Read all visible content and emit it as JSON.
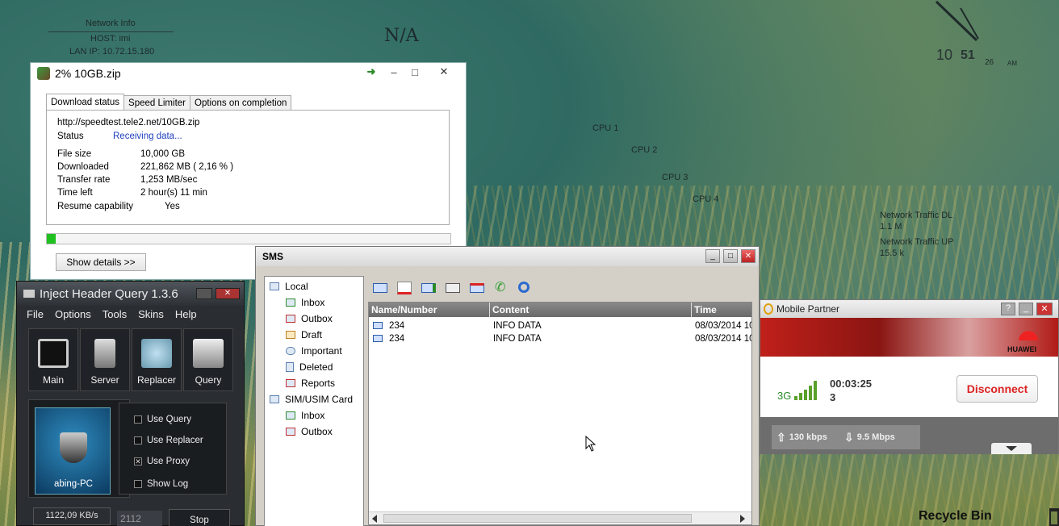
{
  "desktop": {
    "network_info_title": "Network Info",
    "host": "HOST: imi",
    "lan_ip": "LAN IP: 10.72.15.180",
    "na": "N/A",
    "cpu1": "CPU 1",
    "cpu2": "CPU 2",
    "cpu3": "CPU 3",
    "cpu4": "CPU 4",
    "traffic_dl_label": "Network Traffic DL",
    "traffic_dl_value": "1.1 M",
    "traffic_ul_label": "Network Traffic UP",
    "traffic_ul_value": "15.5 k",
    "clock_hour": "10",
    "clock_min": "51",
    "clock_day": "26",
    "clock_ampm": "AM",
    "recycle_bin": "Recycle Bin"
  },
  "download": {
    "title": "2% 10GB.zip",
    "tabs": [
      "Download status",
      "Speed Limiter",
      "Options on completion"
    ],
    "url": "http://speedtest.tele2.net/10GB.zip",
    "status_label": "Status",
    "status_value": "Receiving data...",
    "file_size_label": "File size",
    "file_size_value": "10,000  GB",
    "downloaded_label": "Downloaded",
    "downloaded_value": "221,862  MB  ( 2,16 % )",
    "rate_label": "Transfer rate",
    "rate_value": "1,253  MB/sec",
    "time_left_label": "Time left",
    "time_left_value": "2 hour(s) 11 min",
    "resume_label": "Resume capability",
    "resume_value": "Yes",
    "progress": 0.0216,
    "show_details": "Show details >>",
    "min": "–",
    "max": "□",
    "close": "✕"
  },
  "inject": {
    "title": "Inject Header Query 1.3.6",
    "menu": [
      "File",
      "Options",
      "Tools",
      "Skins",
      "Help"
    ],
    "tools": [
      "Main",
      "Server",
      "Replacer",
      "Query"
    ],
    "pc_name": "abing-PC",
    "options": [
      {
        "label": "Use Query",
        "checked": false
      },
      {
        "label": "Use Replacer",
        "checked": false
      },
      {
        "label": "Use Proxy",
        "checked": true
      },
      {
        "label": "Show Log",
        "checked": false
      }
    ],
    "speed": "1122,09 KB/s",
    "port": "2112",
    "stop": "Stop"
  },
  "sms": {
    "title": "SMS",
    "tree": {
      "local": "Local",
      "inbox": "Inbox",
      "outbox": "Outbox",
      "draft": "Draft",
      "important": "Important",
      "deleted": "Deleted",
      "reports": "Reports",
      "sim": "SIM/USIM Card",
      "sim_inbox": "Inbox",
      "sim_outbox": "Outbox"
    },
    "columns": [
      "Name/Number",
      "Content",
      "Time"
    ],
    "rows": [
      {
        "number": "234",
        "content": "INFO DATA",
        "time": "08/03/2014 10"
      },
      {
        "number": "234",
        "content": "INFO DATA",
        "time": "08/03/2014 10"
      }
    ]
  },
  "mobile": {
    "title": "Mobile Partner",
    "brand": "HUAWEI",
    "network": "3G",
    "duration": "00:03:25",
    "count": "3",
    "disconnect": "Disconnect",
    "up": "130 kbps",
    "down": "9.5 Mbps"
  }
}
